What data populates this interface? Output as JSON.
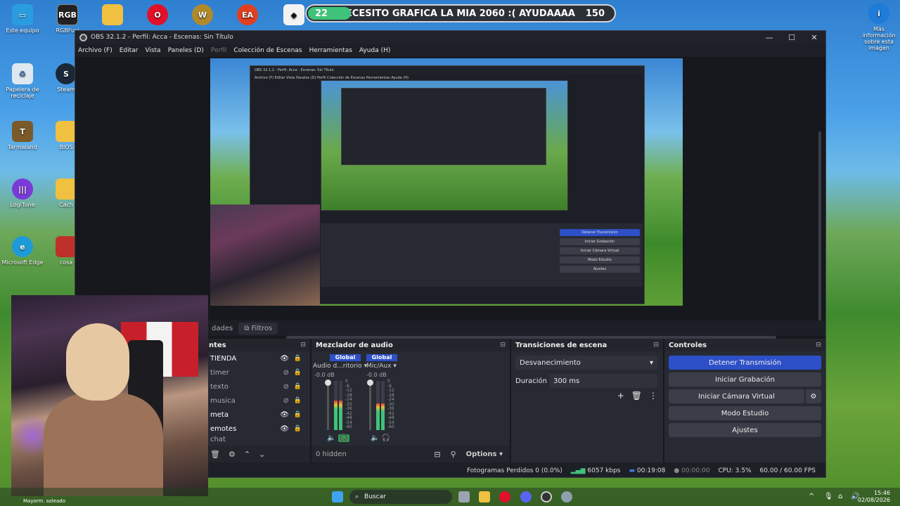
{
  "desktop": {
    "icons": [
      {
        "label": "Este equipo"
      },
      {
        "label": "RGBFusi"
      },
      {
        "label": "Papelera de reciclaje"
      },
      {
        "label": "Steam"
      },
      {
        "label": "Tarmaland"
      },
      {
        "label": "BIOS"
      },
      {
        "label": "LogiTune"
      },
      {
        "label": "Cach"
      },
      {
        "label": "Microsoft Edge"
      },
      {
        "label": "cosa"
      }
    ],
    "top_icon_labels": [
      "RGB"
    ],
    "right_info": "Más información sobre esta imagen"
  },
  "banner": {
    "left_count": "22",
    "text": "NECESITO GRAFICA LA MIA 2060 :( AYUDAAAA",
    "right_count": "150",
    "progress_fraction": 0.14
  },
  "obs": {
    "title": "OBS 32.1.2 - Perfil: Acca - Escenas: Sin Título",
    "menu": [
      "Archivo (F)",
      "Editar",
      "Vista",
      "Paneles (D)",
      "Perfil",
      "Colección de Escenas",
      "Herramientas",
      "Ayuda (H)"
    ],
    "nested_title": "OBS 32.1.2 - Perfil: Acca - Escenas: Sin Título",
    "nested_menu": "Archivo (F)   Editar   Vista   Paneles (D)   Perfil   Colección de Escenas   Herramientas   Ayuda (H)",
    "nested_controls": [
      "Detener Transmisión",
      "Iniciar Grabación",
      "Iniciar Cámara Virtual",
      "Modo Estudio",
      "Ajustes"
    ],
    "tabs": {
      "props": "dades",
      "filters": "Filtros"
    },
    "sources": {
      "header": "ntes",
      "items": [
        {
          "label": "TIENDA",
          "visible": true
        },
        {
          "label": "timer",
          "visible": false
        },
        {
          "label": "texto",
          "visible": false
        },
        {
          "label": "musica",
          "visible": false
        },
        {
          "label": "meta",
          "visible": true
        },
        {
          "label": "emotes",
          "visible": true
        },
        {
          "label": "chat",
          "visible": false
        }
      ]
    },
    "mixer": {
      "header": "Mezclador de audio",
      "channels": [
        {
          "global": "Global",
          "name": "Audio d...ritorio",
          "db": "-0.0 dB",
          "level": 0.6
        },
        {
          "global": "Global",
          "name": "Mic/Aux",
          "db": "-0.0 dB",
          "level": 0.55
        }
      ],
      "scale": [
        "0",
        "-6",
        "-12",
        "-18",
        "-24",
        "-30",
        "-36",
        "-42",
        "-48",
        "-54",
        "-60"
      ],
      "hidden": "0 hidden",
      "options": "Options"
    },
    "transitions": {
      "header": "Transiciones de escena",
      "selected": "Desvanecimiento",
      "duration_label": "Duración",
      "duration_value": "300 ms"
    },
    "controls": {
      "header": "Controles",
      "stop_stream": "Detener Transmisión",
      "start_record": "Iniciar Grabación",
      "virtual_cam": "Iniciar Cámara Virtual",
      "studio_mode": "Modo Estudio",
      "settings": "Ajustes"
    },
    "status": {
      "dropped": "Fotogramas Perdidos 0 (0.0%)",
      "bitrate": "6057 kbps",
      "live_time": "00:19:08",
      "rec_time": "00:00:00",
      "cpu": "CPU: 3.5%",
      "fps": "60.00 / 60.00 FPS"
    }
  },
  "webcam": {
    "weather": "Mayorm. soleado"
  },
  "taskbar": {
    "search": "Buscar",
    "time": "15:46",
    "date": "02/08/2026"
  },
  "colors": {
    "accent": "#2d50c8",
    "obs_bg": "#1d1f26",
    "dock_bg": "#272a32"
  }
}
